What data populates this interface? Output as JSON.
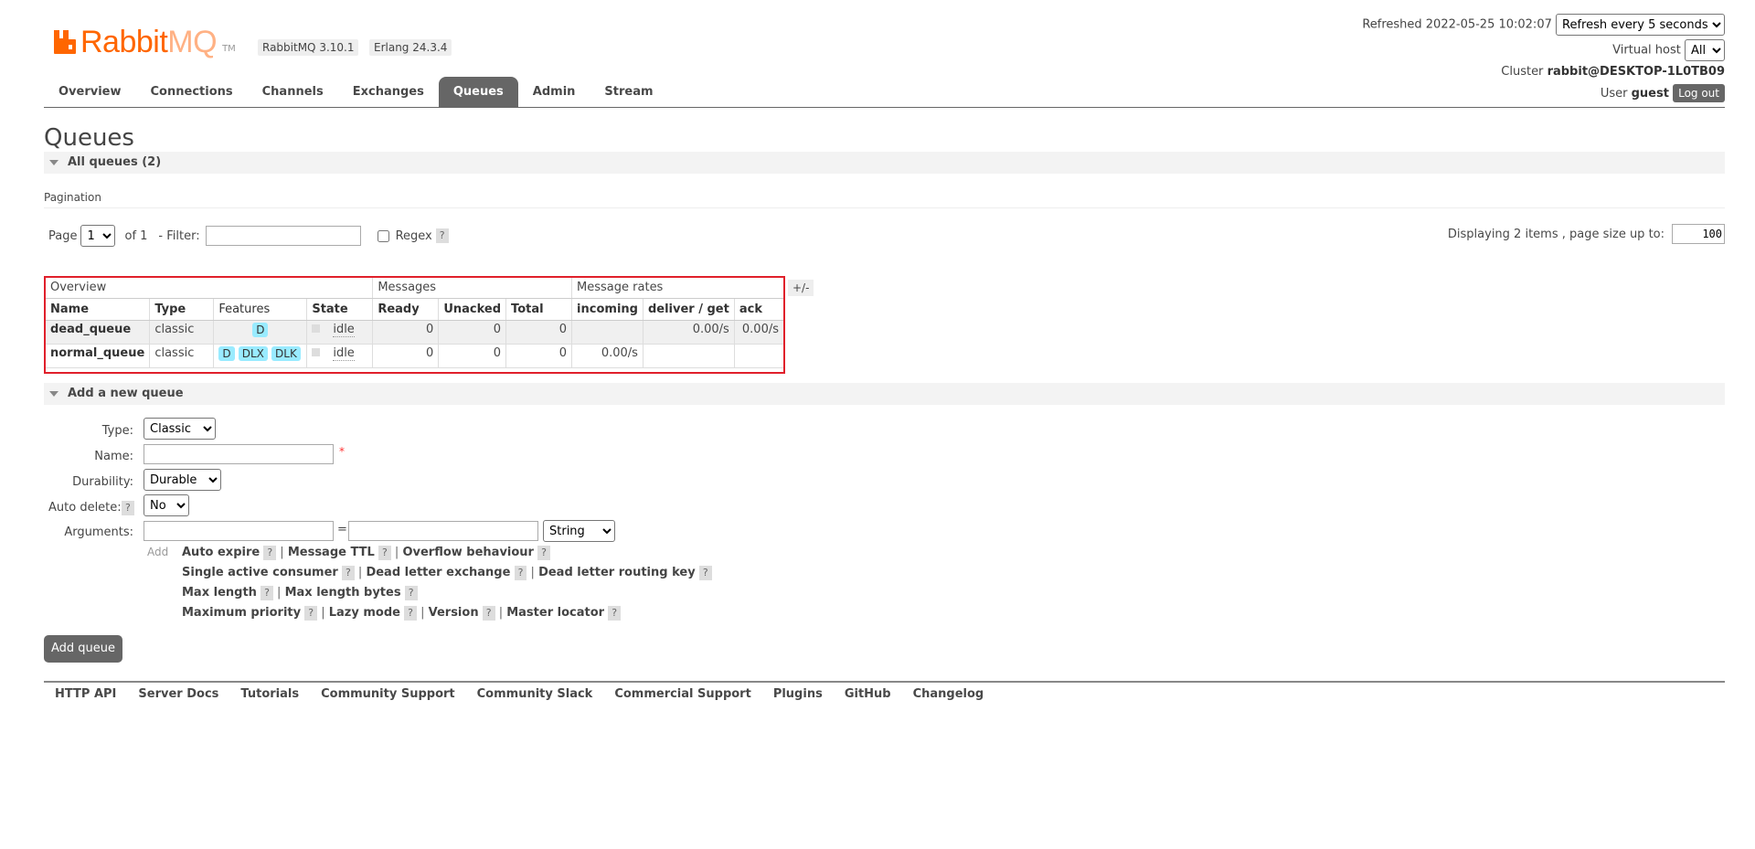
{
  "header": {
    "logo_text_main": "Rabbit",
    "logo_text_mq": "MQ",
    "logo_tm": "TM",
    "rabbitmq_version": "RabbitMQ 3.10.1",
    "erlang_version": "Erlang 24.3.4",
    "refreshed_label": "Refreshed 2022-05-25 10:02:07",
    "refresh_select": "Refresh every 5 seconds",
    "virtual_host_label": "Virtual host",
    "virtual_host_value": "All",
    "cluster_label": "Cluster",
    "cluster_value": "rabbit@DESKTOP-1L0TB09",
    "user_label": "User",
    "user_value": "guest",
    "logout_label": "Log out"
  },
  "nav": {
    "tabs": [
      {
        "label": "Overview"
      },
      {
        "label": "Connections"
      },
      {
        "label": "Channels"
      },
      {
        "label": "Exchanges"
      },
      {
        "label": "Queues"
      },
      {
        "label": "Admin"
      },
      {
        "label": "Stream"
      }
    ]
  },
  "page_title": "Queues",
  "all_queues_title": "All queues (2)",
  "pagination": {
    "title": "Pagination",
    "page_label": "Page",
    "page_value": "1",
    "of_label": "of 1",
    "filter_label": "- Filter:",
    "filter_value": "",
    "regex_label": "Regex",
    "help": "?",
    "displaying_label": "Displaying 2 items , page size up to:",
    "page_size": "100"
  },
  "table": {
    "groups": [
      "Overview",
      "Messages",
      "Message rates"
    ],
    "columns": [
      "Name",
      "Type",
      "Features",
      "State",
      "Ready",
      "Unacked",
      "Total",
      "incoming",
      "deliver / get",
      "ack"
    ],
    "rows": [
      {
        "name": "dead_queue",
        "type": "classic",
        "features": [
          "D"
        ],
        "state": "idle",
        "ready": "0",
        "unacked": "0",
        "total": "0",
        "incoming": "",
        "deliver_get": "0.00/s",
        "ack": "0.00/s"
      },
      {
        "name": "normal_queue",
        "type": "classic",
        "features": [
          "D",
          "DLX",
          "DLK"
        ],
        "state": "idle",
        "ready": "0",
        "unacked": "0",
        "total": "0",
        "incoming": "0.00/s",
        "deliver_get": "",
        "ack": ""
      }
    ],
    "toggle_label": "+/-"
  },
  "add_queue": {
    "title": "Add a new queue",
    "type_label": "Type:",
    "type_value": "Classic",
    "name_label": "Name:",
    "name_value": "",
    "required_mark": "*",
    "durability_label": "Durability:",
    "durability_value": "Durable",
    "auto_delete_label": "Auto delete:",
    "auto_delete_help": "?",
    "auto_delete_value": "No",
    "arguments_label": "Arguments:",
    "equals": "=",
    "arg_type_value": "String",
    "add_label": "Add",
    "arg_lines": [
      [
        "Auto expire",
        "Message TTL",
        "Overflow behaviour"
      ],
      [
        "Single active consumer",
        "Dead letter exchange",
        "Dead letter routing key"
      ],
      [
        "Max length",
        "Max length bytes"
      ],
      [
        "Maximum priority",
        "Lazy mode",
        "Version",
        "Master locator"
      ]
    ],
    "submit_label": "Add queue"
  },
  "footer": {
    "links": [
      "HTTP API",
      "Server Docs",
      "Tutorials",
      "Community Support",
      "Community Slack",
      "Commercial Support",
      "Plugins",
      "GitHub",
      "Changelog"
    ]
  },
  "colors": {
    "brand_orange": "#ff6600",
    "tab_active": "#666666",
    "feature_badge": "#99ebff",
    "highlight_border": "#e0202b"
  }
}
